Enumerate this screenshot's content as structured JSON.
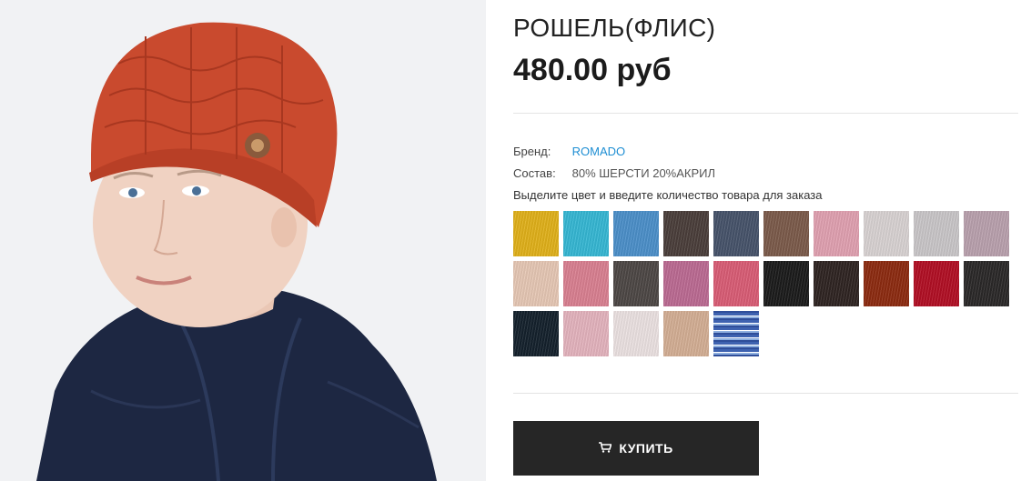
{
  "product": {
    "title": "РОШЕЛЬ(ФЛИС)",
    "price": "480.00 руб"
  },
  "attributes": {
    "brand_label": "Бренд:",
    "brand_value": "ROMADO",
    "composition_label": "Состав:",
    "composition_value": "80% ШЕРСТИ 20%АКРИЛ"
  },
  "color_hint": "Выделите цвет и введите количество товара для заказа",
  "swatches": [
    {
      "color": "#e0b01a"
    },
    {
      "color": "#35b7d3"
    },
    {
      "color": "#4b8fc9"
    },
    {
      "color": "#4a3e3a"
    },
    {
      "color": "#46536a"
    },
    {
      "color": "#7b5a4a"
    },
    {
      "color": "#e0a0b0"
    },
    {
      "color": "#d8d2d2"
    },
    {
      "color": "#c9c6c8"
    },
    {
      "color": "#b9a0ad"
    },
    {
      "color": "#e6c7b4"
    },
    {
      "color": "#d97f90"
    },
    {
      "color": "#4d4745"
    },
    {
      "color": "#bb6a92"
    },
    {
      "color": "#d95c75"
    },
    {
      "color": "#1b1b1b"
    },
    {
      "color": "#2f2422"
    },
    {
      "color": "#8c2a10"
    },
    {
      "color": "#b10f24"
    },
    {
      "color": "#2b2828"
    },
    {
      "color": "#14212c"
    },
    {
      "color": "#e3b3bd"
    },
    {
      "color": "#ebe1e1"
    },
    {
      "color": "#d3ae94"
    },
    {
      "color": "#4f73b7",
      "pattern": "melange"
    }
  ],
  "buy_button": {
    "icon": "cart-icon",
    "label": "КУПИТЬ"
  }
}
